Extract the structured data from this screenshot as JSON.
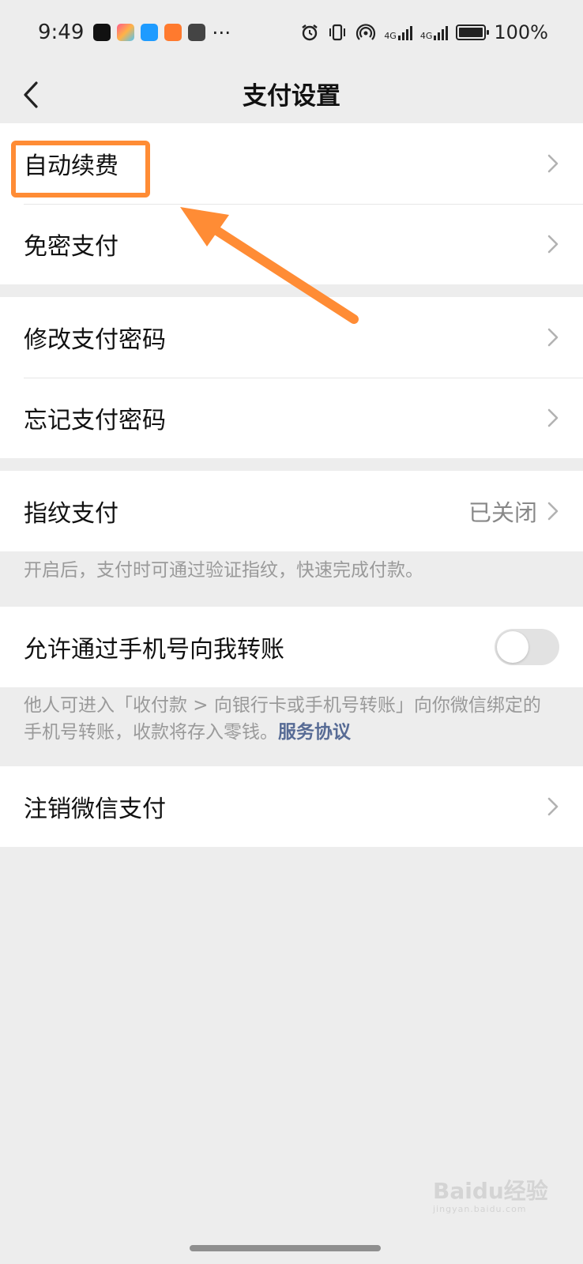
{
  "status_bar": {
    "time": "9:49",
    "more": "···",
    "network_1": "4G",
    "network_2": "4G",
    "battery": "100%"
  },
  "header": {
    "title": "支付设置"
  },
  "groups": [
    {
      "items": [
        {
          "label": "自动续费"
        },
        {
          "label": "免密支付"
        }
      ]
    },
    {
      "items": [
        {
          "label": "修改支付密码"
        },
        {
          "label": "忘记支付密码"
        }
      ]
    },
    {
      "items": [
        {
          "label": "指纹支付",
          "value": "已关闭"
        }
      ]
    }
  ],
  "fingerprint_hint": "开启后，支付时可通过验证指纹，快速完成付款。",
  "phone_transfer": {
    "label": "允许通过手机号向我转账",
    "enabled": false,
    "hint": "他人可进入「收付款 > 向银行卡或手机号转账」向你微信绑定的手机号转账，收款将存入零钱。",
    "link": "服务协议"
  },
  "cancel": {
    "label": "注销微信支付"
  },
  "annotation": {
    "color": "#ff8c35"
  },
  "watermark": {
    "text": "Baidu经验",
    "sub": "jingyan.baidu.com"
  },
  "colors": {
    "background": "#ededed",
    "link": "#576b95",
    "highlight": "#ff8c35"
  }
}
